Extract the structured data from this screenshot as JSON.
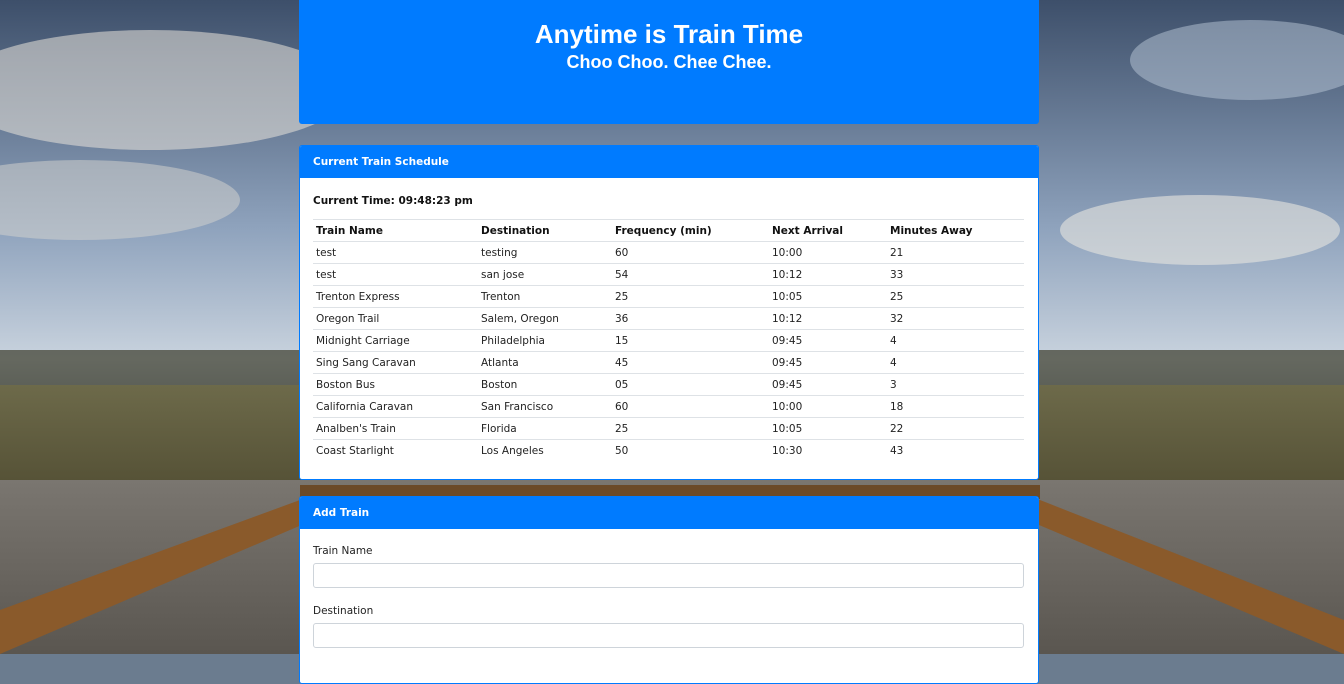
{
  "header": {
    "title": "Anytime is Train Time",
    "subtitle": "Choo Choo. Chee Chee."
  },
  "schedule": {
    "heading": "Current Train Schedule",
    "current_time": "Current Time: 09:48:23 pm",
    "columns": [
      "Train Name",
      "Destination",
      "Frequency (min)",
      "Next Arrival",
      "Minutes Away"
    ],
    "rows": [
      [
        "test",
        "testing",
        "60",
        "10:00",
        "21"
      ],
      [
        "test",
        "san jose",
        "54",
        "10:12",
        "33"
      ],
      [
        "Trenton Express",
        "Trenton",
        "25",
        "10:05",
        "25"
      ],
      [
        "Oregon Trail",
        "Salem, Oregon",
        "36",
        "10:12",
        "32"
      ],
      [
        "Midnight Carriage",
        "Philadelphia",
        "15",
        "09:45",
        "4"
      ],
      [
        "Sing Sang Caravan",
        "Atlanta",
        "45",
        "09:45",
        "4"
      ],
      [
        "Boston Bus",
        "Boston",
        "05",
        "09:45",
        "3"
      ],
      [
        "California Caravan",
        "San Francisco",
        "60",
        "10:00",
        "18"
      ],
      [
        "Analben's Train",
        "Florida",
        "25",
        "10:05",
        "22"
      ],
      [
        "Coast Starlight",
        "Los Angeles",
        "50",
        "10:30",
        "43"
      ]
    ]
  },
  "add_train": {
    "heading": "Add Train",
    "train_name_label": "Train Name",
    "train_name_value": "",
    "destination_label": "Destination",
    "destination_value": ""
  },
  "colors": {
    "primary": "#007bff"
  }
}
